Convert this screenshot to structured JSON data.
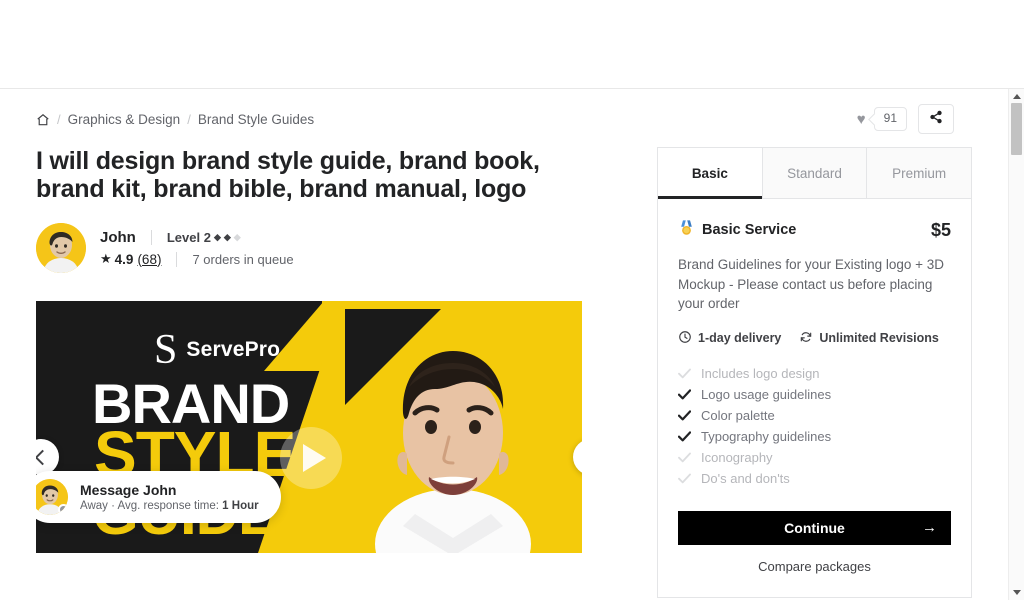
{
  "breadcrumb": {
    "home_icon": "home-icon",
    "separator": "/",
    "items": [
      {
        "label": "Graphics & Design"
      },
      {
        "label": "Brand Style Guides"
      }
    ]
  },
  "actions": {
    "heart_icon": "heart-icon",
    "favorite_count": "91",
    "share_icon": "share-icon"
  },
  "gig": {
    "title": "I will design brand style guide, brand book, brand kit, brand bible, brand manual, logo"
  },
  "seller": {
    "name": "John",
    "level": "Level 2",
    "level_filled": 2,
    "level_total": 3,
    "star_icon": "star-icon",
    "rating": "4.9",
    "reviews": "(68)",
    "queue": "7 orders in queue",
    "avatar_alt": "seller-avatar"
  },
  "gallery": {
    "slide": {
      "logo_letter": "S",
      "logo_name": "ServePro",
      "line1": "BRAND",
      "line2": "STYLE",
      "line3": "GUIDE",
      "bg_color": "#1a1a1a",
      "accent_color": "#f4cb0b"
    },
    "play_icon": "play-icon",
    "prev_icon": "chevron-left-icon",
    "next_icon": "chevron-right-icon"
  },
  "message_pill": {
    "title": "Message John",
    "status": "Away",
    "dot": "·",
    "response_prefix": "Avg. response time:",
    "response_time": "1 Hour",
    "status_color": "#95979d"
  },
  "packages": {
    "tabs": [
      {
        "label": "Basic",
        "active": true
      },
      {
        "label": "Standard",
        "active": false
      },
      {
        "label": "Premium",
        "active": false
      }
    ],
    "medal_icon": "medal-icon",
    "name": "Basic Service",
    "price": "$5",
    "description": "Brand Guidelines for your Existing logo + 3D Mockup - Please contact us before placing your order",
    "delivery_icon": "clock-icon",
    "delivery": "1-day delivery",
    "revisions_icon": "refresh-icon",
    "revisions": "Unlimited Revisions",
    "features": [
      {
        "label": "Includes logo design",
        "included": false
      },
      {
        "label": "Logo usage guidelines",
        "included": true
      },
      {
        "label": "Color palette",
        "included": true
      },
      {
        "label": "Typography guidelines",
        "included": true
      },
      {
        "label": "Iconography",
        "included": false
      },
      {
        "label": "Do's and don'ts",
        "included": false
      }
    ],
    "continue_label": "Continue",
    "continue_arrow": "→",
    "compare_label": "Compare packages"
  },
  "scrollbar": {
    "up_icon": "scroll-up-arrow-icon",
    "down_icon": "scroll-down-arrow-icon",
    "thumb": "scroll-thumb"
  }
}
